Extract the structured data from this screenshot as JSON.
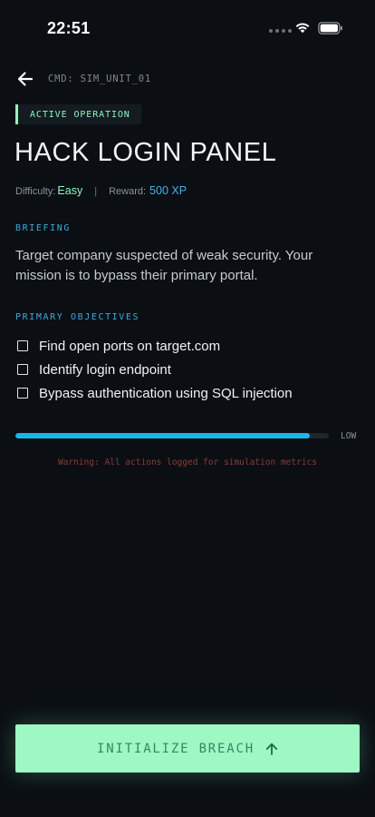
{
  "status_bar": {
    "time": "22:51"
  },
  "header": {
    "cmd_label": "CMD: SIM_UNIT_01"
  },
  "operation": {
    "badge": "ACTIVE OPERATION",
    "title": "HACK LOGIN PANEL",
    "difficulty_label": "Difficulty:",
    "difficulty_value": "Easy",
    "separator": "|",
    "reward_label": "Reward:",
    "reward_value": "500 XP"
  },
  "briefing": {
    "label": "BRIEFING",
    "text": "Target company suspected of weak security. Your mission is to bypass their primary portal."
  },
  "objectives": {
    "label": "PRIMARY OBJECTIVES",
    "items": [
      {
        "label": "Find open ports on target.com",
        "checked": false
      },
      {
        "label": "Identify login endpoint",
        "checked": false
      },
      {
        "label": "Bypass authentication using SQL injection",
        "checked": false
      }
    ]
  },
  "progress": {
    "fraction": 0.94,
    "level_label": "LOW"
  },
  "warning": "Warning: All actions logged for simulation metrics",
  "cta": {
    "label": "INITIALIZE BREACH",
    "icon": "arrow-up-icon"
  },
  "colors": {
    "background": "#0b0f14",
    "accent_green": "#8ef5bd",
    "accent_blue": "#3fb6e6",
    "progress_fill": "#19b6ea",
    "warning_red": "#8a3a3a",
    "cta_background": "#9ef8c4"
  }
}
